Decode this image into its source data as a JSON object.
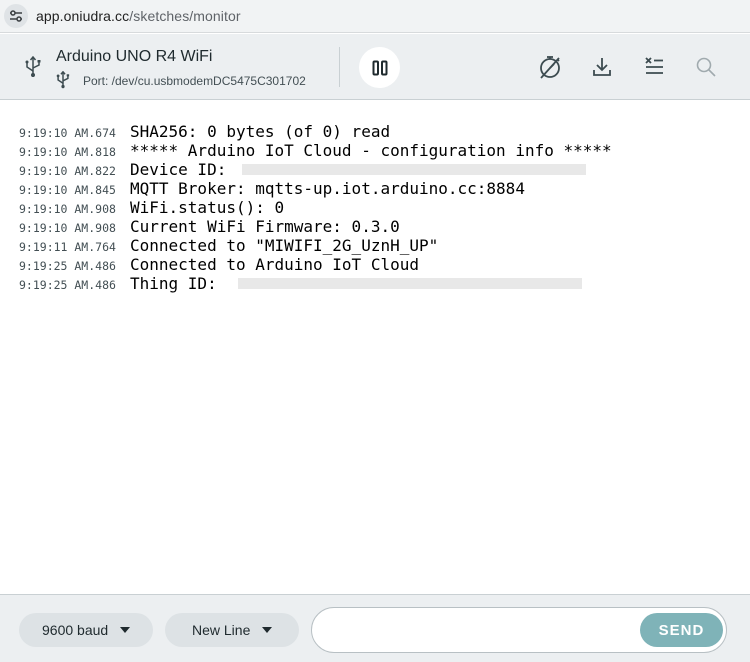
{
  "browser": {
    "url_domain": "app.oniudra.cc",
    "url_path": "/sketches/monitor"
  },
  "header": {
    "board_name": "Arduino UNO R4 WiFi",
    "port_label": "Port: /dev/cu.usbmodemDC5475C301702",
    "icons": [
      "usb-icon",
      "pause-icon",
      "timestamp-toggle-icon",
      "download-icon",
      "clear-output-icon",
      "search-icon"
    ]
  },
  "log": {
    "lines": [
      {
        "timestamp": "9:19:10 AM.674",
        "message": "SHA256: 0 bytes (of 0) read"
      },
      {
        "timestamp": "9:19:10 AM.818",
        "message": "***** Arduino IoT Cloud - configuration info *****"
      },
      {
        "timestamp": "9:19:10 AM.822",
        "message": "Device ID: "
      },
      {
        "timestamp": "9:19:10 AM.845",
        "message": "MQTT Broker: mqtts-up.iot.arduino.cc:8884"
      },
      {
        "timestamp": "9:19:10 AM.908",
        "message": "WiFi.status(): 0"
      },
      {
        "timestamp": "9:19:10 AM.908",
        "message": "Current WiFi Firmware: 0.3.0"
      },
      {
        "timestamp": "9:19:11 AM.764",
        "message": "Connected to \"MIWIFI_2G_UznH_UP\""
      },
      {
        "timestamp": "9:19:25 AM.486",
        "message": "Connected to Arduino IoT Cloud"
      },
      {
        "timestamp": "9:19:25 AM.486",
        "message": "Thing ID: "
      }
    ]
  },
  "footer": {
    "baud_rate": "9600 baud",
    "line_ending": "New Line",
    "message_placeholder": "",
    "send_label": "SEND"
  },
  "colors": {
    "toolbar_bg": "#eceff1",
    "send_button": "#7fb3b8",
    "select_bg": "#dde2e5"
  }
}
